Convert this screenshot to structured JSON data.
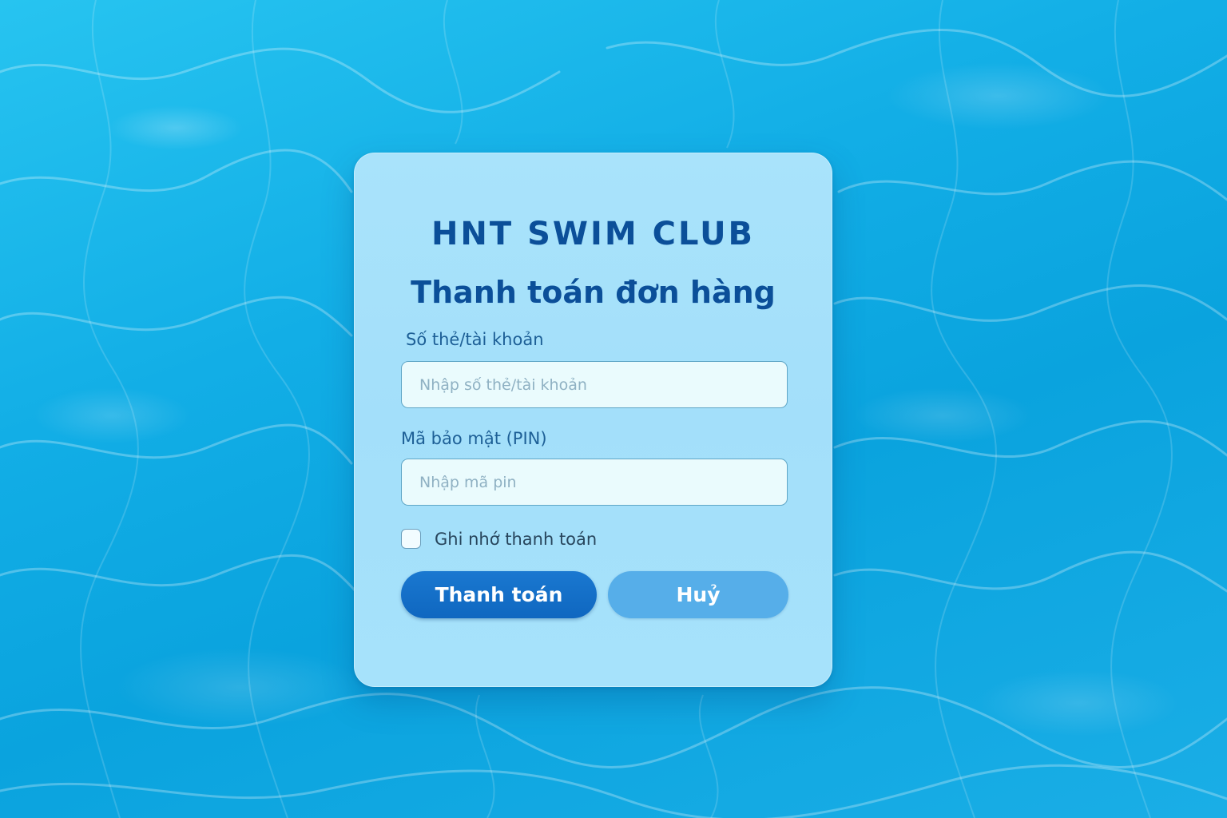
{
  "card": {
    "brand": "HNT SWIM CLUB",
    "title": "Thanh toán đơn hàng"
  },
  "form": {
    "card_label": "Số thẻ/tài khoản",
    "card_placeholder": "Nhập số thẻ/tài khoản",
    "card_value": "",
    "pin_label": "Mã bảo mật (PIN)",
    "pin_placeholder": "Nhập mã pin",
    "pin_value": "",
    "remember_label": "Ghi nhớ thanh toán",
    "remember_checked": false
  },
  "actions": {
    "pay_label": "Thanh toán",
    "cancel_label": "Huỷ"
  },
  "colors": {
    "brand": "#0b4f99",
    "primary_button": "#1270c8",
    "secondary_button": "#56aee9",
    "background": "#12aee6"
  },
  "icons": {
    "background": "water-background"
  }
}
